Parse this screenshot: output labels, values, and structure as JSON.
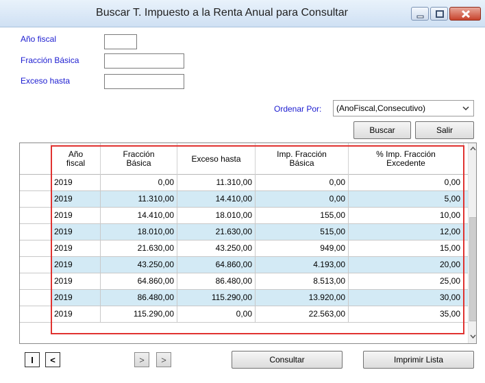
{
  "window": {
    "title": "Buscar T. Impuesto a la Renta Anual para Consultar"
  },
  "filters": {
    "anio_fiscal_label": "Año fiscal",
    "anio_fiscal_value": "",
    "fraccion_basica_label": "Fracción Básica",
    "fraccion_basica_value": "",
    "exceso_hasta_label": "Exceso hasta",
    "exceso_hasta_value": ""
  },
  "sort": {
    "label": "Ordenar Por:",
    "selected": "(AnoFiscal,Consecutivo)"
  },
  "actions": {
    "buscar": "Buscar",
    "salir": "Salir",
    "consultar": "Consultar",
    "imprimir": "Imprimir Lista"
  },
  "nav": {
    "first": "I",
    "prev": "<",
    "next": ">",
    "last": ">"
  },
  "table": {
    "columns": [
      "Año\nfiscal",
      "Fracción\nBásica",
      "Exceso hasta",
      "Imp. Fracción\nBásica",
      "% Imp. Fracción\nExcedente"
    ],
    "rows": [
      [
        "2019",
        "0,00",
        "11.310,00",
        "0,00",
        "0,00"
      ],
      [
        "2019",
        "11.310,00",
        "14.410,00",
        "0,00",
        "5,00"
      ],
      [
        "2019",
        "14.410,00",
        "18.010,00",
        "155,00",
        "10,00"
      ],
      [
        "2019",
        "18.010,00",
        "21.630,00",
        "515,00",
        "12,00"
      ],
      [
        "2019",
        "21.630,00",
        "43.250,00",
        "949,00",
        "15,00"
      ],
      [
        "2019",
        "43.250,00",
        "64.860,00",
        "4.193,00",
        "20,00"
      ],
      [
        "2019",
        "64.860,00",
        "86.480,00",
        "8.513,00",
        "25,00"
      ],
      [
        "2019",
        "86.480,00",
        "115.290,00",
        "13.920,00",
        "30,00"
      ],
      [
        "2019",
        "115.290,00",
        "0,00",
        "22.563,00",
        "35,00"
      ]
    ]
  },
  "colors": {
    "label_blue": "#1a1ad0",
    "alt_row": "#d3eaf5",
    "highlight": "#e0312f"
  }
}
